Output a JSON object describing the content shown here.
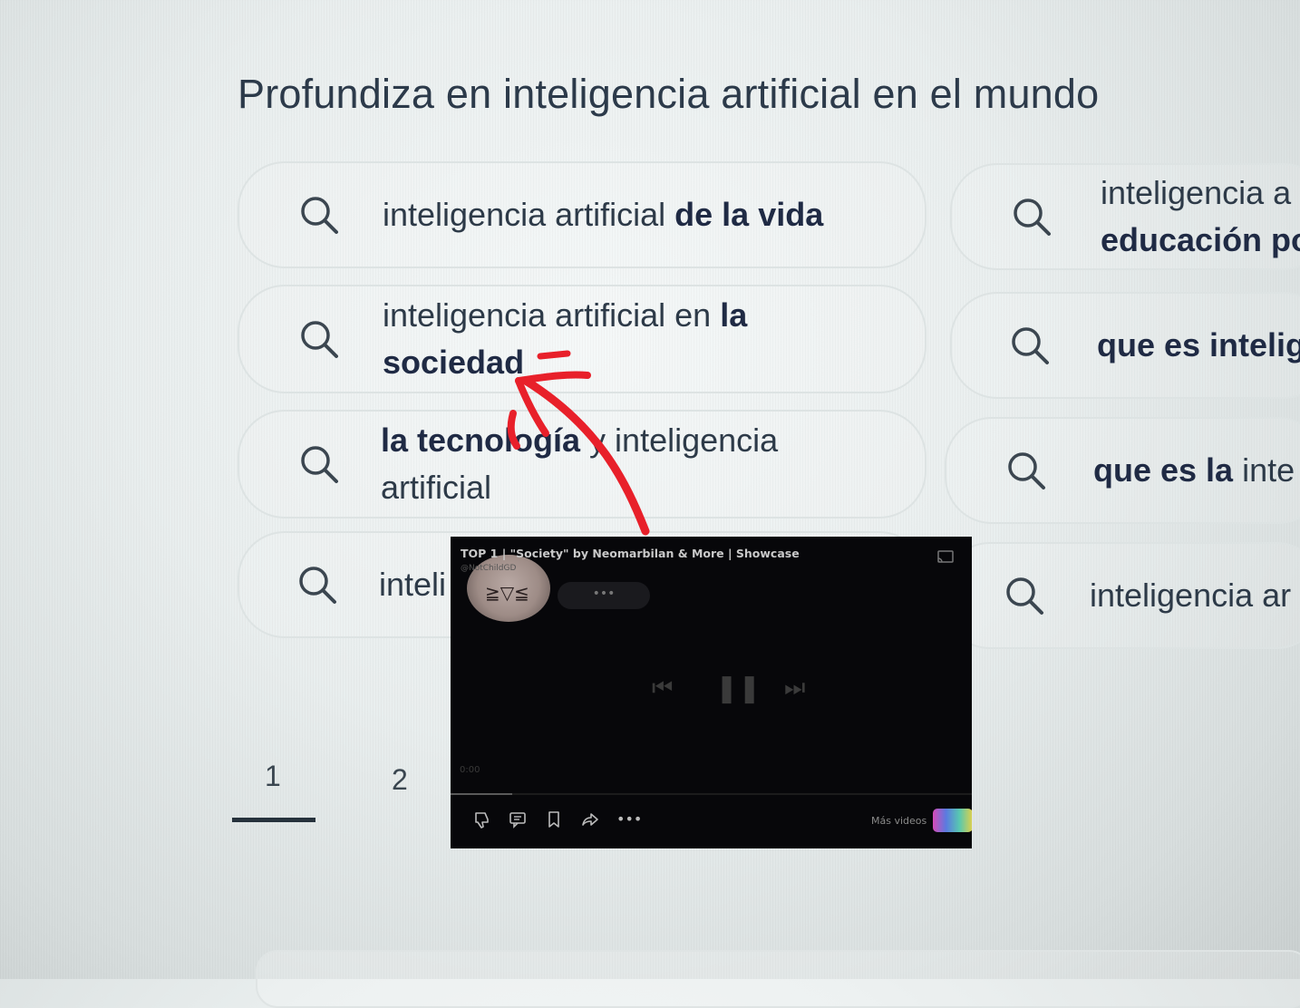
{
  "heading": "Profundiza en inteligencia artificial en el mundo",
  "suggestions_left": [
    {
      "normal": "inteligencia artificial ",
      "bold": "de la vida",
      "icon": "search-icon"
    },
    {
      "line1_normal": "inteligencia artificial en ",
      "line1_bold": "la",
      "line2_bold": "sociedad",
      "icon": "search-icon"
    },
    {
      "line1_bold": "la tecnología ",
      "line1_normal": "y inteligencia",
      "line2_normal": "artificial",
      "icon": "search-icon"
    },
    {
      "normal": "inteli",
      "icon": "search-icon"
    }
  ],
  "suggestions_right": [
    {
      "line1_normal": "inteligencia a",
      "line2_bold": "educación po",
      "icon": "search-icon"
    },
    {
      "bold": "que es intelig",
      "icon": "search-icon"
    },
    {
      "bold": "que es la ",
      "normal": "inte",
      "icon": "search-icon"
    },
    {
      "normal": "inteligencia ar",
      "icon": "search-icon"
    }
  ],
  "pagination": {
    "page1": "1",
    "page2": "2",
    "current": "1"
  },
  "annotation": {
    "color": "#e8202a",
    "icon": "arrow-icon"
  },
  "video_player": {
    "title": "TOP 1 | \"Society\" by Neomarbilan & More | Showcase",
    "channel": "@NotChildGD",
    "more_button": "•••",
    "more_videos": "Más videos",
    "time": "0:00",
    "icons": [
      "cast-icon",
      "previous-icon",
      "pause-icon",
      "next-icon",
      "dislike-icon",
      "comment-icon",
      "save-icon",
      "share-icon",
      "more-icon"
    ]
  },
  "colors": {
    "text": "#2d3a48",
    "bold_text": "#1f2a44",
    "chip_border": "#dde3e3",
    "annotation": "#e8202a",
    "player_bg": "#07070a"
  }
}
